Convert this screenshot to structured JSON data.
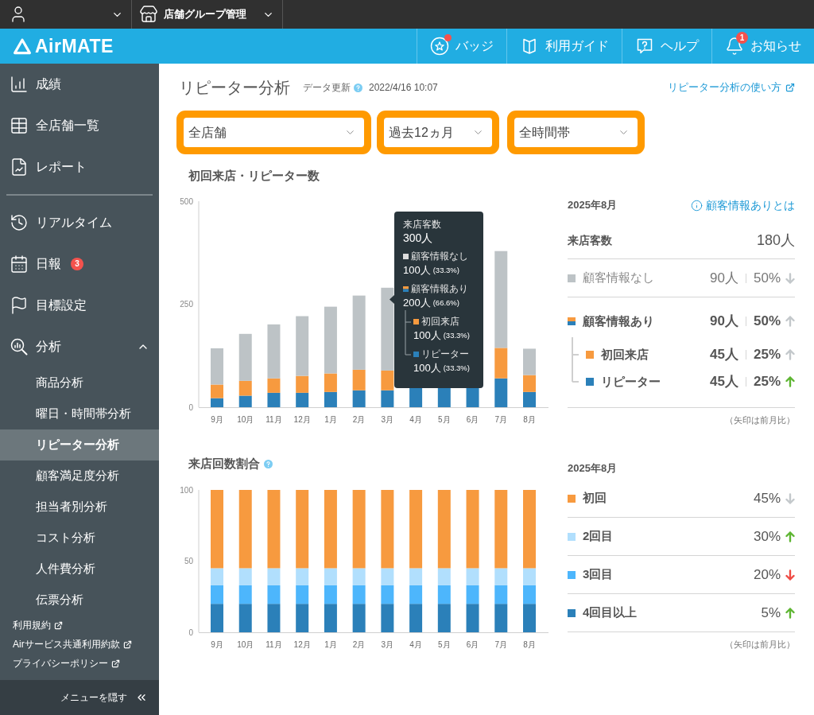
{
  "top_bar": {
    "store_menu": "店舗グループ管理"
  },
  "header": {
    "logo": "AirMATE",
    "nav": [
      {
        "label": "バッジ",
        "notification_dot": true
      },
      {
        "label": "利用ガイド",
        "notification_dot": false
      },
      {
        "label": "ヘルプ",
        "notification_dot": false
      },
      {
        "label": "お知らせ",
        "notification_dot": false,
        "badge": "1"
      }
    ]
  },
  "sidebar": {
    "groups": [
      {
        "items": [
          {
            "label": "成績",
            "selected": false
          },
          {
            "label": "全店舗一覧",
            "selected": false
          },
          {
            "label": "レポート",
            "selected": false
          }
        ]
      },
      {
        "items": [
          {
            "label": "リアルタイム",
            "selected": false
          },
          {
            "label": "日報",
            "badge": "3",
            "selected": false
          },
          {
            "label": "目標設定",
            "selected": false
          },
          {
            "label": "分析",
            "selected": false,
            "expanded": true,
            "children": [
              {
                "label": "商品分析",
                "selected": false
              },
              {
                "label": "曜日・時間帯分析",
                "selected": false
              },
              {
                "label": "リピーター分析",
                "selected": true
              },
              {
                "label": "顧客満足度分析",
                "selected": false
              },
              {
                "label": "担当者別分析",
                "selected": false
              },
              {
                "label": "コスト分析",
                "selected": false
              },
              {
                "label": "人件費分析",
                "selected": false
              },
              {
                "label": "伝票分析",
                "selected": false
              }
            ]
          }
        ]
      }
    ],
    "footer_links": [
      "利用規約",
      "Airサービス共通利用約款",
      "プライバシーポリシー"
    ],
    "hide_menu": "メニューを隠す"
  },
  "page": {
    "title": "リピーター分析",
    "updated_label": "データ更新",
    "updated_at": "2022/4/16 10:07",
    "help_link": "リピーター分析の使い方"
  },
  "filters": [
    {
      "value": "全店舗"
    },
    {
      "value": "過去12ヵ月"
    },
    {
      "value": "全時間帯"
    }
  ],
  "sections": [
    {
      "title": "初回来店・リピーター数",
      "help_icon": false,
      "chart_data": {
        "type": "bar",
        "categories": [
          "9月",
          "10月",
          "11月",
          "12月",
          "1月",
          "2月",
          "3月",
          "4月",
          "5月",
          "6月",
          "7月",
          "8月"
        ],
        "series": [
          {
            "color": "#2b80b9",
            "values": [
              22,
              28,
              35,
              35,
              37,
              41,
              41,
              50,
              50,
              50,
              70,
              37
            ]
          },
          {
            "color": "#f79a3f",
            "values": [
              33,
              36,
              35,
              41,
              45,
              50,
              48,
              null,
              null,
              null,
              74,
              41
            ]
          },
          {
            "color": "#bdc3c6",
            "values": [
              88,
              114,
              131,
              145,
              162,
              180,
              201,
              null,
              null,
              null,
              235,
              64
            ]
          }
        ],
        "stacked": true,
        "ylim": [
          0,
          500
        ],
        "yticks": [
          0,
          250,
          500
        ]
      },
      "tooltip": {
        "title": "来店客数",
        "total": "300人",
        "items": [
          {
            "label": "顧客情報なし",
            "color": "#dcdcdc",
            "count": "100人",
            "share": "(33.3%)"
          },
          {
            "label": "顧客情報あり",
            "count": "200人",
            "share": "(66.6%)",
            "children": [
              {
                "label": "初回来店",
                "color": "#f79a3f",
                "count": "100人",
                "share": "(33.3%)"
              },
              {
                "label": "リピーター",
                "color": "#2b80b9",
                "count": "100人",
                "share": "(33.3%)"
              }
            ]
          }
        ]
      },
      "summary": {
        "month": "2025年8月",
        "help_link": "顧客情報ありとは",
        "total": {
          "label": "来店客数",
          "value": "180人"
        },
        "rows": [
          {
            "kind": "muted",
            "label": "顧客情報なし",
            "color": "#bdc3c6",
            "count": "90人",
            "share": "50%",
            "up": false,
            "highlighted": false
          },
          {
            "kind": "group",
            "label": "顧客情報あり",
            "count": "90人",
            "share": "50%",
            "up": true,
            "highlighted": false,
            "children": [
              {
                "kind": "detail",
                "label": "初回来店",
                "color": "#f79a3f",
                "count": "45人",
                "share": "25%",
                "up": true,
                "highlighted": false
              },
              {
                "kind": "detail",
                "label": "リピーター",
                "color": "#2b80b9",
                "count": "45人",
                "share": "25%",
                "up": true,
                "highlighted": true
              }
            ]
          }
        ],
        "note": "（矢印は前月比）"
      }
    },
    {
      "title": "来店回数割合",
      "help_icon": true,
      "chart_data": {
        "type": "bar",
        "categories": [
          "9月",
          "10月",
          "11月",
          "12月",
          "1月",
          "2月",
          "3月",
          "4月",
          "5月",
          "6月",
          "7月",
          "8月"
        ],
        "series": [
          {
            "color": "#2b80b9",
            "values": [
              20,
              20,
              20,
              20,
              20,
              20,
              20,
              20,
              20,
              20,
              20,
              20
            ]
          },
          {
            "color": "#4db6fc",
            "values": [
              13,
              13,
              13,
              13,
              13,
              13,
              13,
              13,
              13,
              13,
              13,
              13
            ]
          },
          {
            "color": "#b1dffd",
            "values": [
              12,
              12,
              12,
              12,
              12,
              12,
              12,
              12,
              12,
              12,
              12,
              12
            ]
          },
          {
            "color": "#f79a3f",
            "values": [
              55,
              55,
              55,
              55,
              55,
              55,
              55,
              55,
              55,
              55,
              55,
              55
            ]
          }
        ],
        "stacked": true,
        "ylim": [
          0,
          100
        ],
        "yticks": [
          0,
          50,
          100
        ]
      },
      "summary": {
        "month": "2025年8月",
        "rows": [
          {
            "kind": "share",
            "label": "初回",
            "color": "#f79a3f",
            "share": "45%",
            "up": false,
            "highlighted": false
          },
          {
            "kind": "share",
            "label": "2回目",
            "color": "#b1dffd",
            "share": "30%",
            "up": true,
            "highlighted": true
          },
          {
            "kind": "share",
            "label": "3回目",
            "color": "#4db6fc",
            "share": "20%",
            "up": false,
            "highlighted": true
          },
          {
            "kind": "share",
            "label": "4回目以上",
            "color": "#2b80b9",
            "share": "5%",
            "up": true,
            "highlighted": true
          }
        ],
        "note": "（矢印は前月比）"
      }
    }
  ]
}
